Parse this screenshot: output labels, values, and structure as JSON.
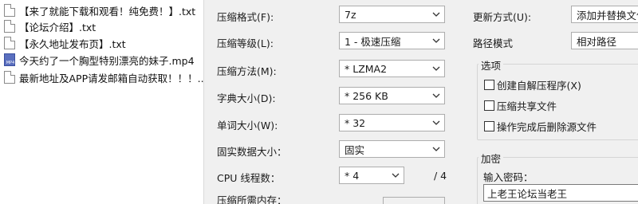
{
  "files": [
    {
      "name": "【来了就能下载和观看！纯免费！】.txt",
      "icon": "txt-file-icon"
    },
    {
      "name": "【论坛介绍】.txt",
      "icon": "txt-file-icon"
    },
    {
      "name": "【永久地址发布页】.txt",
      "icon": "txt-file-icon"
    },
    {
      "name": "今天约了一个胸型特别漂亮的妹子.mp4",
      "icon": "mp4-file-icon"
    },
    {
      "name": "最新地址及APP请发邮箱自动获取！！！....",
      "icon": "txt-file-icon"
    }
  ],
  "settings": {
    "format": {
      "label": "压缩格式(F):",
      "value": "7z"
    },
    "level": {
      "label": "压缩等级(L):",
      "value": "1 - 极速压缩"
    },
    "method": {
      "label": "压缩方法(M):",
      "value": "* LZMA2"
    },
    "dict": {
      "label": "字典大小(D):",
      "value": "* 256 KB"
    },
    "word": {
      "label": "单词大小(W):",
      "value": "* 32"
    },
    "solid": {
      "label": "固实数据大小：",
      "value": "固实"
    },
    "threads": {
      "label": "CPU 线程数：",
      "value": "* 4",
      "max": "/ 4"
    },
    "memory": {
      "label": "压缩所需内存："
    }
  },
  "right": {
    "update": {
      "label": "更新方式(U):",
      "value": "添加并替换文件"
    },
    "path": {
      "label": "路径模式",
      "value": "相对路径"
    },
    "options": {
      "title": "选项",
      "items": [
        "创建自解压程序(X)",
        "压缩共享文件",
        "操作完成后删除源文件"
      ]
    },
    "encrypt": {
      "title": "加密",
      "pwd_label": "输入密码：",
      "pwd_value": "上老王论坛当老王"
    }
  }
}
